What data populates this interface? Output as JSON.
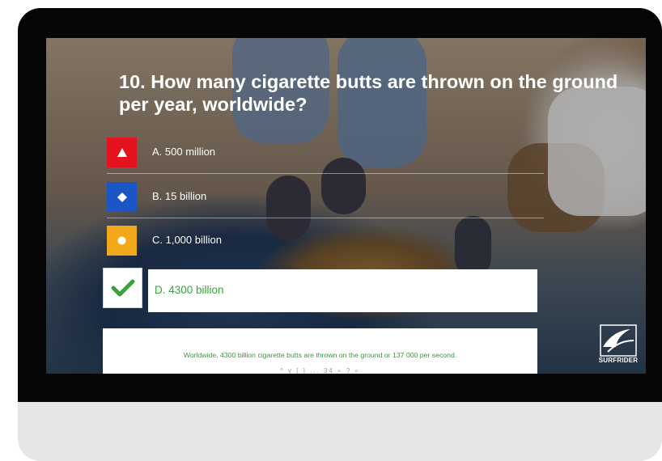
{
  "question": "10. How many cigarette butts are thrown on the ground per year, worldwide?",
  "answers": [
    {
      "label": "A. 500 million",
      "color": "#e5121f",
      "icon": "triangle-icon"
    },
    {
      "label": "B. 15 billion",
      "color": "#1a56c6",
      "icon": "diamond-icon"
    },
    {
      "label": "C. 1,000 billion",
      "color": "#f2a81a",
      "icon": "circle-icon"
    }
  ],
  "correct_answer": {
    "label": "D. 4300 billion",
    "icon": "check-icon",
    "color": "#3aa23c"
  },
  "explanation": "Worldwide, 4300 billion cigarette butts are thrown on the ground or 137 000 per second.",
  "toolbar_glyphs": "^ v [ ] ... 34 ⌕ ?  ⌕",
  "logo": {
    "text": "SURFRIDER",
    "icon": "wave-logo-icon"
  }
}
